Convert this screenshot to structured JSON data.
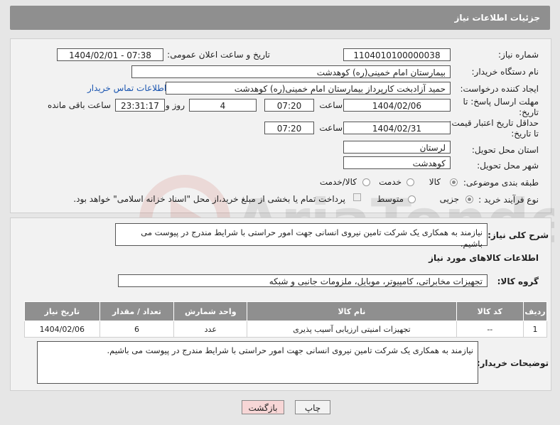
{
  "header": {
    "title": "جزئیات اطلاعات نیاز"
  },
  "form": {
    "need_number_label": "شماره نیاز:",
    "need_number": "1104010100000038",
    "announce_label": "تاریخ و ساعت اعلان عمومی:",
    "announce_value": "1404/02/01 - 07:38",
    "buyer_org_label": "نام دستگاه خریدار:",
    "buyer_org": "بیمارستان امام خمینی(ره) کوهدشت",
    "creator_label": "ایجاد کننده درخواست:",
    "creator": "حمید آزادبخت کارپرداز بیمارستان امام خمینی(ره) کوهدشت",
    "contact_link": "اطلاعات تماس خریدار",
    "deadline_label_1": "مهلت ارسال پاسخ: تا",
    "deadline_label_2": "تاریخ:",
    "deadline_date": "1404/02/06",
    "time_label": "ساعت",
    "deadline_time": "07:20",
    "days_value": "4",
    "days_label": "روز و",
    "remaining_time": "23:31:17",
    "remaining_label": "ساعت باقی مانده",
    "validity_label_1": "حداقل تاریخ اعتبار قیمت:",
    "validity_label_2": "تا تاریخ:",
    "validity_date": "1404/02/31",
    "validity_time": "07:20",
    "province_label": "استان محل تحویل:",
    "province": "لرستان",
    "city_label": "شهر محل تحویل:",
    "city": "کوهدشت",
    "category_label": "طبقه بندی موضوعی:",
    "category_options": [
      "کالا",
      "خدمت",
      "کالا/خدمت"
    ],
    "process_label": "نوع فرآیند خرید :",
    "process_options": [
      "جزیی",
      "متوسط"
    ],
    "payment_note": "پرداخت تمام یا بخشی از مبلغ خرید،از محل \"اسناد خزانه اسلامی\" خواهد بود."
  },
  "description": {
    "label": "شرح کلی نیاز:",
    "text": "نیازمند به همکاری یک شرکت تامین نیروی انسانی جهت امور حراستی با شرایط مندرج در پیوست می باشیم."
  },
  "goods": {
    "section_title": "اطلاعات کالاهای مورد نیاز",
    "group_label": "گروه کالا:",
    "group_value": "تجهیزات مخابراتی، کامپیوتر، موبایل، ملزومات جانبی و شبکه",
    "columns": [
      "ردیف",
      "کد کالا",
      "نام کالا",
      "واحد شمارش",
      "تعداد / مقدار",
      "تاریخ نیاز"
    ],
    "rows": [
      [
        "1",
        "--",
        "تجهیزات امنیتی ارزیابی آسیب پذیری",
        "عدد",
        "6",
        "1404/02/06"
      ]
    ]
  },
  "buyer_notes": {
    "label": "توضیحات خریدار:",
    "text": "نیازمند به همکاری یک شرکت تامین نیروی انسانی جهت امور حراستی با شرایط مندرج در پیوست می باشیم."
  },
  "buttons": {
    "print": "چاپ",
    "back": "بازگشت"
  },
  "watermark": {
    "text": "AriaTender.net"
  },
  "colors": {
    "header_bg": "#8f8f8f",
    "link": "#1a55b0",
    "back_button_bg": "#f7d6d6"
  }
}
